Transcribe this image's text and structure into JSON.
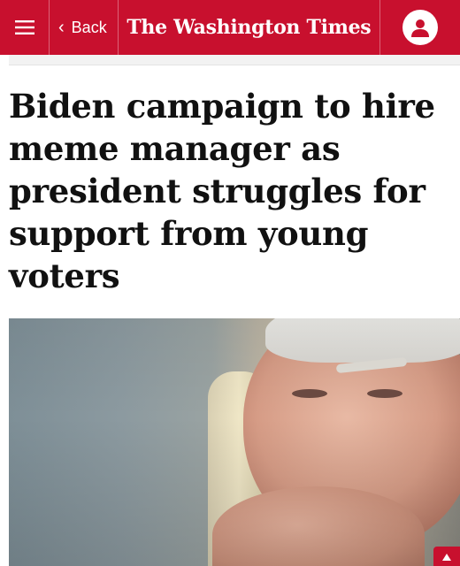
{
  "header": {
    "back_label": "Back",
    "brand": "The Washington Times",
    "icons": {
      "menu": "hamburger-menu-icon",
      "back": "chevron-left-icon",
      "account": "user-account-icon"
    },
    "brand_color": "#c8102e"
  },
  "article": {
    "headline": "Biden campaign to hire meme manager as president struggles for support from young voters"
  },
  "hero_image": {
    "badge_icon": "expand-icon"
  }
}
